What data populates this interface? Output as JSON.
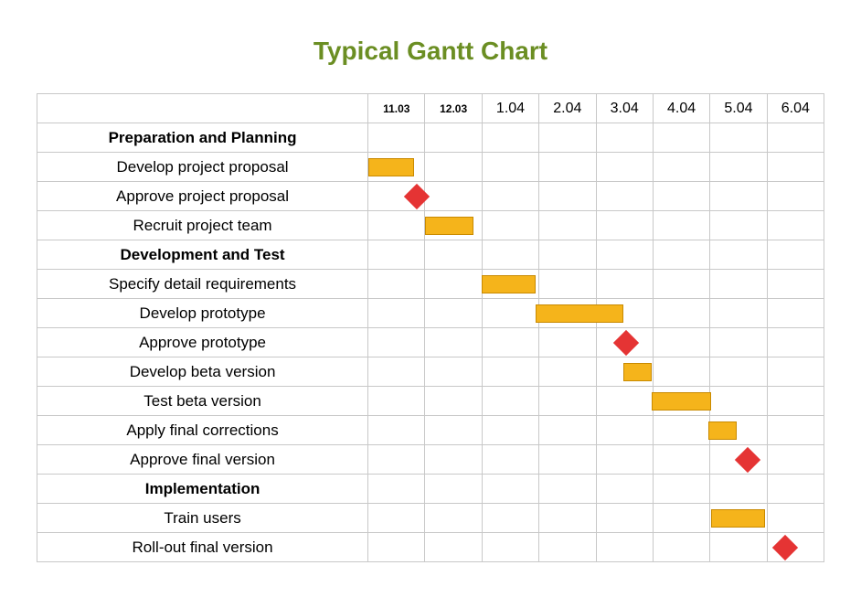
{
  "title": "Typical Gantt Chart",
  "timeline": [
    "11.03",
    "12.03",
    "1.04",
    "2.04",
    "3.04",
    "4.04",
    "5.04",
    "6.04"
  ],
  "rows": [
    {
      "type": "group",
      "label": "Preparation and Planning"
    },
    {
      "type": "task",
      "label": "Develop project proposal",
      "bar": {
        "start": 0,
        "end": 0.8
      }
    },
    {
      "type": "task",
      "label": "Approve project proposal",
      "milestone": 0.85
    },
    {
      "type": "task",
      "label": "Recruit project team",
      "bar": {
        "start": 1,
        "end": 1.85
      }
    },
    {
      "type": "group",
      "label": "Development and Test"
    },
    {
      "type": "task",
      "label": "Specify detail requirements",
      "bar": {
        "start": 2,
        "end": 2.95
      }
    },
    {
      "type": "task",
      "label": "Develop prototype",
      "bar": {
        "start": 2.95,
        "end": 4.5
      }
    },
    {
      "type": "task",
      "label": "Approve prototype",
      "milestone": 4.55
    },
    {
      "type": "task",
      "label": "Develop beta version",
      "bar": {
        "start": 4.5,
        "end": 5
      }
    },
    {
      "type": "task",
      "label": "Test beta version",
      "bar": {
        "start": 5,
        "end": 6.05
      }
    },
    {
      "type": "task",
      "label": "Apply final corrections",
      "bar": {
        "start": 6,
        "end": 6.5
      }
    },
    {
      "type": "task",
      "label": "Approve final version",
      "milestone": 6.7
    },
    {
      "type": "group",
      "label": "Implementation"
    },
    {
      "type": "task",
      "label": "Train users",
      "bar": {
        "start": 6.05,
        "end": 7
      }
    },
    {
      "type": "task",
      "label": "Roll-out final version",
      "milestone": 7.35
    }
  ],
  "chart_data": {
    "type": "gantt",
    "title": "Typical Gantt Chart",
    "time_axis": [
      "11.03",
      "12.03",
      "1.04",
      "2.04",
      "3.04",
      "4.04",
      "5.04",
      "6.04"
    ],
    "groups": [
      {
        "name": "Preparation and Planning",
        "tasks": [
          {
            "name": "Develop project proposal",
            "start": "11.03",
            "end": "11.03",
            "duration_units": 0.8
          },
          {
            "name": "Approve project proposal",
            "milestone_at": "11.03/12.03 boundary"
          },
          {
            "name": "Recruit project team",
            "start": "12.03",
            "end": "12.03",
            "duration_units": 0.85
          }
        ]
      },
      {
        "name": "Development and Test",
        "tasks": [
          {
            "name": "Specify detail requirements",
            "start": "1.04",
            "end": "1.04",
            "duration_units": 0.95
          },
          {
            "name": "Develop prototype",
            "start": "2.04",
            "end": "3.04",
            "duration_units": 1.55
          },
          {
            "name": "Approve prototype",
            "milestone_at": "mid 3.04"
          },
          {
            "name": "Develop beta version",
            "start": "3.04",
            "end": "4.04",
            "duration_units": 0.5
          },
          {
            "name": "Test beta version",
            "start": "4.04",
            "end": "5.04",
            "duration_units": 1.05
          },
          {
            "name": "Apply final corrections",
            "start": "5.04",
            "end": "5.04",
            "duration_units": 0.5
          },
          {
            "name": "Approve final version",
            "milestone_at": "late 5.04"
          }
        ]
      },
      {
        "name": "Implementation",
        "tasks": [
          {
            "name": "Train users",
            "start": "5.04",
            "end": "6.04",
            "duration_units": 0.95
          },
          {
            "name": "Roll-out final version",
            "milestone_at": "early-mid 6.04"
          }
        ]
      }
    ]
  }
}
